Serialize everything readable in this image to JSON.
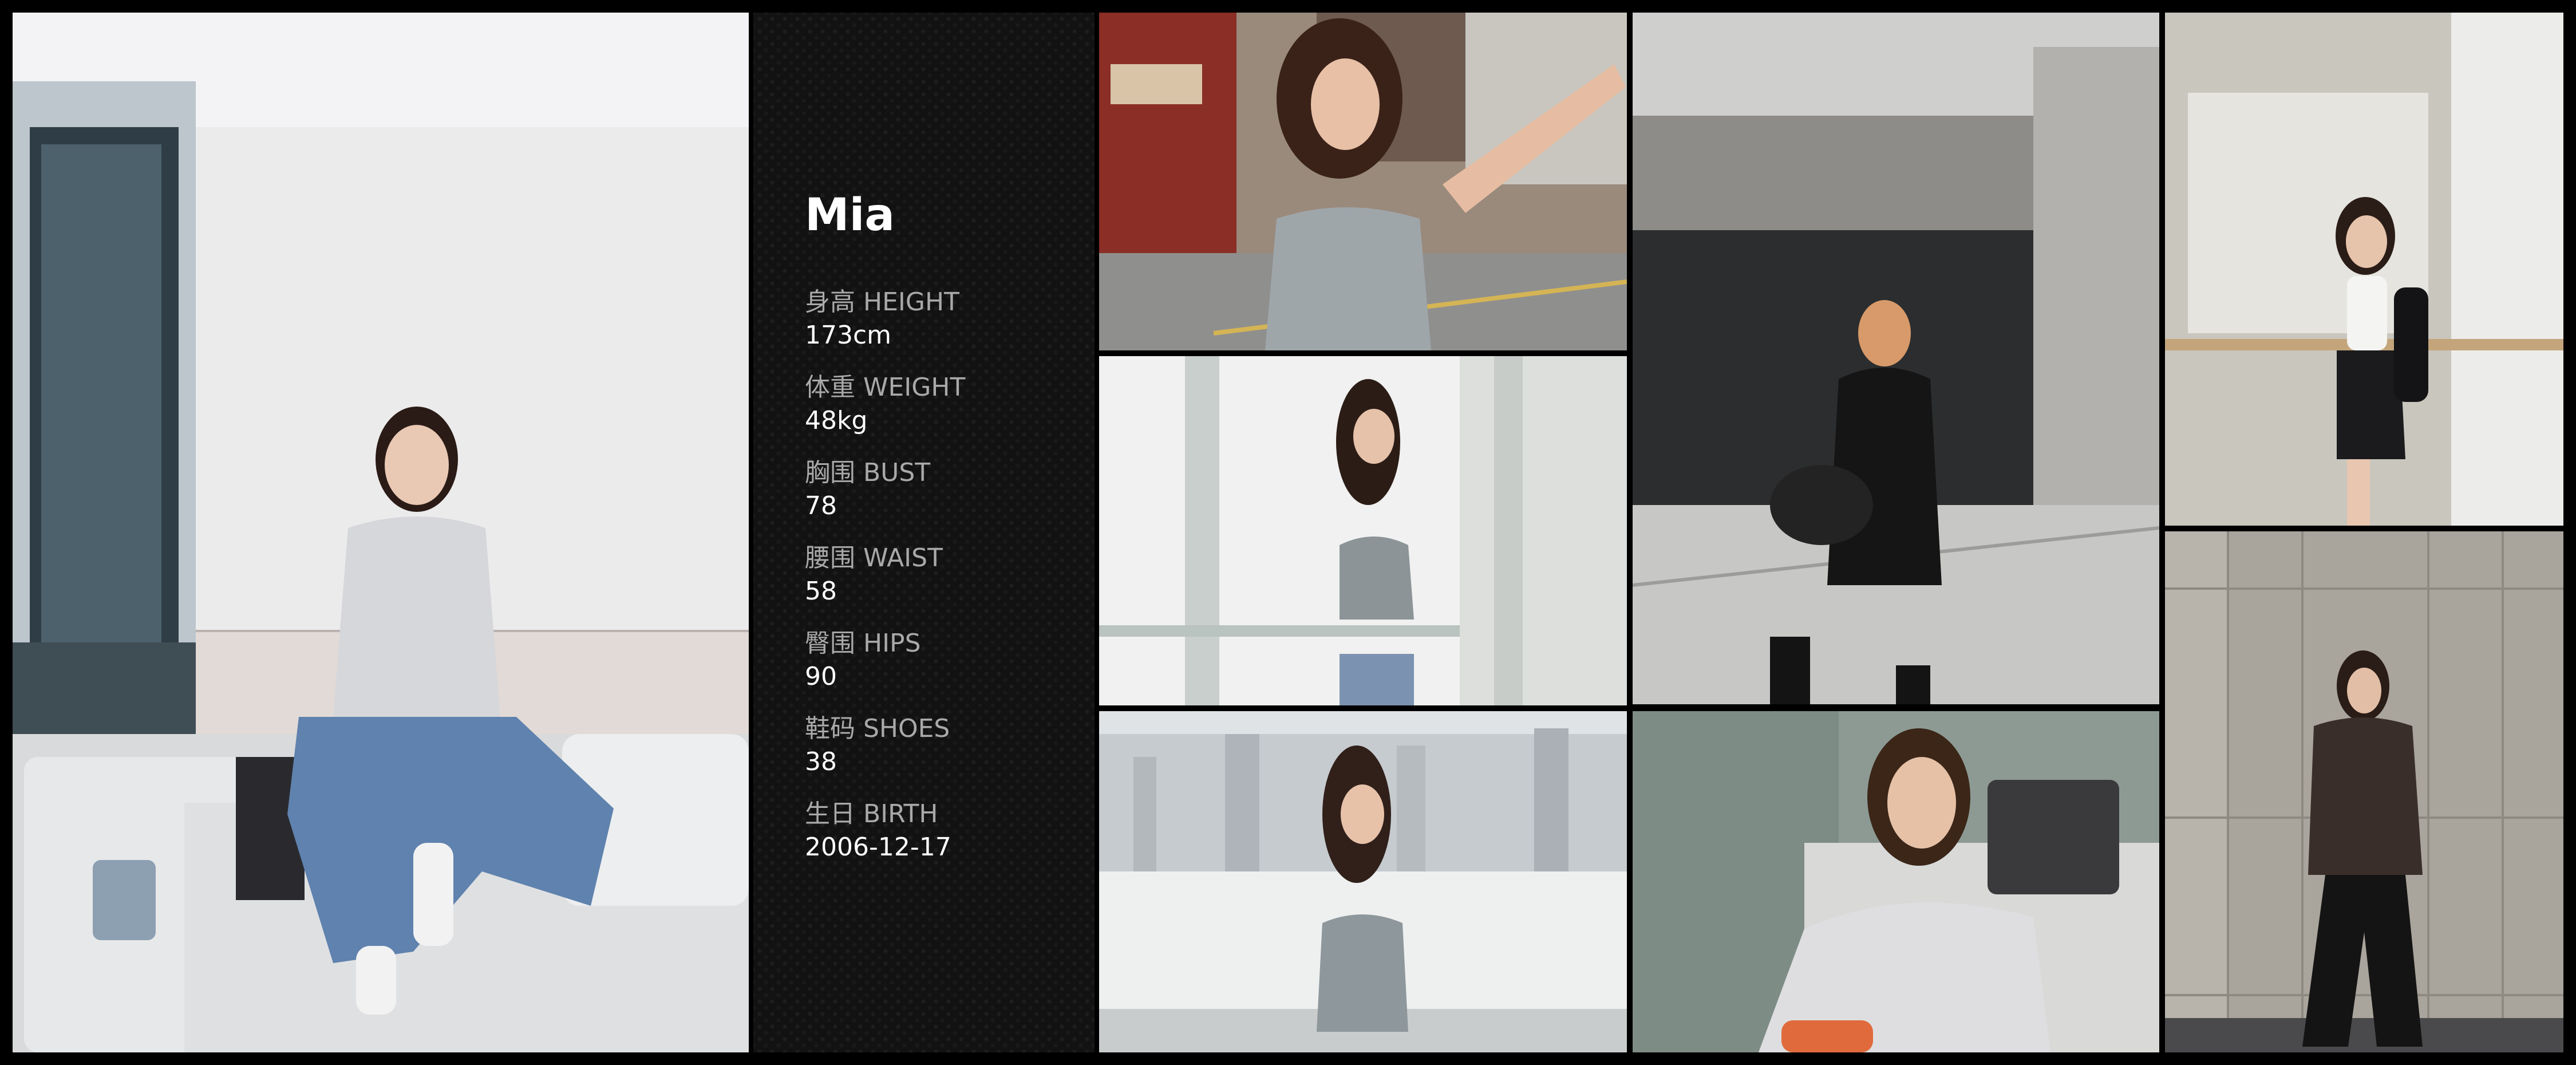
{
  "model": {
    "name": "Mia"
  },
  "stats": [
    {
      "label": "身高 HEIGHT",
      "value": "173cm"
    },
    {
      "label": "体重 WEIGHT",
      "value": "48kg"
    },
    {
      "label": "胸围 BUST",
      "value": "78"
    },
    {
      "label": "腰围 WAIST",
      "value": "58"
    },
    {
      "label": "臀围 HIPS",
      "value": "90"
    },
    {
      "label": "鞋码 SHOES",
      "value": "38"
    },
    {
      "label": "生日 BIRTH",
      "value": "2006-12-17"
    }
  ],
  "colors": {
    "background": "#000000",
    "panel": "#121212",
    "label": "#a9a9a9",
    "value": "#ffffff"
  }
}
